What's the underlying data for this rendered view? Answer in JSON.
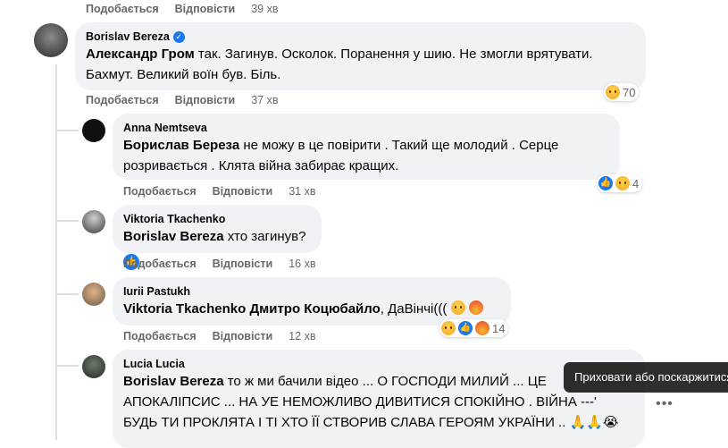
{
  "labels": {
    "like": "Подобається",
    "reply": "Відповісти"
  },
  "top_actions": {
    "time": "39 хв"
  },
  "comments": [
    {
      "author": "Borislav Bereza",
      "mention": "Александр Гром",
      "text_line1": " так. Загинув. Осколок. Поранення у шию. Не змогли врятувати.",
      "text_line2": "Бахмут. Великий воїн був. Біль.",
      "time": "37 хв",
      "reactions": {
        "count": "70",
        "icons": [
          "sad"
        ]
      }
    },
    {
      "author": "Anna Nemtseva",
      "mention": "Борислав Береза",
      "text_line1": " не можу в це повірити . Такий ще молодий . Серце",
      "text_line2": "розривається . Клята війна забирає кращих.",
      "time": "31 хв",
      "reactions": {
        "count": "4",
        "icons": [
          "like",
          "sad"
        ]
      }
    },
    {
      "author": "Viktoria Tkachenko",
      "mention": "Borislav Bereza",
      "text_line1": " хто загинув?",
      "time": "16 хв"
    },
    {
      "author": "Iurii Pastukh",
      "mention": "Viktoria Tkachenko",
      "mention2": "Дмитро Коцюбайло",
      "text_line1": ", ДаВінчі(((",
      "time": "12 хв",
      "reactions": {
        "count": "14",
        "icons": [
          "sad",
          "like",
          "angry"
        ]
      }
    },
    {
      "author": "Lucia Lucia",
      "mention": "Borislav Bereza",
      "text_line1": " то ж ми бачили відео ... О ГОСПОДИ МИЛИЙ ... ЦЕ",
      "text_line2": "АПОКАЛІПСИС ... НА УЕ НЕМОЖЛИВО ДИВИТИСЯ СПОКІЙНО . ВІЙНА ---'",
      "text_line3": "БУДЬ ТИ ПРОКЛЯТА І ТІ ХТО ЇЇ СТВОРИВ СЛАВА ГЕРОЯМ УКРАЇНИ .. 🙏🙏😭"
    }
  ],
  "tooltip": "Приховати або поскаржитися",
  "icons": {
    "verified": "verified-badge-icon",
    "more": "more-options-icon"
  },
  "colors": {
    "accent": "#1877f2",
    "bubble": "#f0f2f5",
    "muted": "#65676b"
  }
}
